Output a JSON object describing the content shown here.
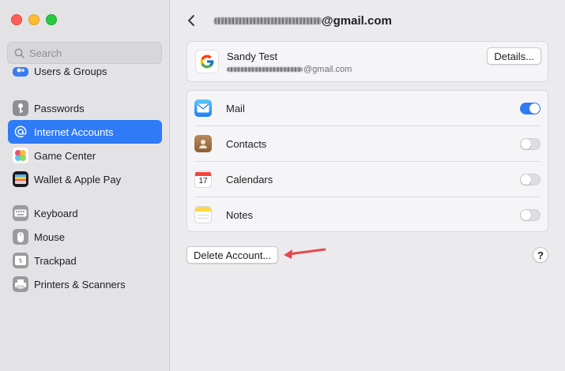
{
  "window": {
    "traffic_lights": [
      "close",
      "minimize",
      "zoom"
    ]
  },
  "search": {
    "placeholder": "Search"
  },
  "sidebar": {
    "items": [
      {
        "label": "Users & Groups",
        "icon": "users-groups-icon"
      },
      {
        "label": "Passwords",
        "icon": "key-icon"
      },
      {
        "label": "Internet Accounts",
        "icon": "at-sign-icon",
        "active": true
      },
      {
        "label": "Game Center",
        "icon": "game-center-icon"
      },
      {
        "label": "Wallet & Apple Pay",
        "icon": "wallet-icon"
      },
      {
        "label": "Keyboard",
        "icon": "keyboard-icon"
      },
      {
        "label": "Mouse",
        "icon": "mouse-icon"
      },
      {
        "label": "Trackpad",
        "icon": "trackpad-icon"
      },
      {
        "label": "Printers & Scanners",
        "icon": "printer-icon"
      }
    ]
  },
  "header": {
    "title_suffix": "@gmail.com"
  },
  "account": {
    "name": "Sandy Test",
    "email_suffix": "@gmail.com",
    "details_label": "Details..."
  },
  "apps": [
    {
      "label": "Mail",
      "icon": "mail-icon",
      "enabled": true
    },
    {
      "label": "Contacts",
      "icon": "contacts-icon",
      "enabled": false
    },
    {
      "label": "Calendars",
      "icon": "calendar-icon",
      "enabled": false,
      "icon_text": "17"
    },
    {
      "label": "Notes",
      "icon": "notes-icon",
      "enabled": false
    }
  ],
  "actions": {
    "delete_label": "Delete Account...",
    "help_label": "?"
  },
  "colors": {
    "accent": "#2f7bf6",
    "annotation_arrow": "#e5484d"
  }
}
